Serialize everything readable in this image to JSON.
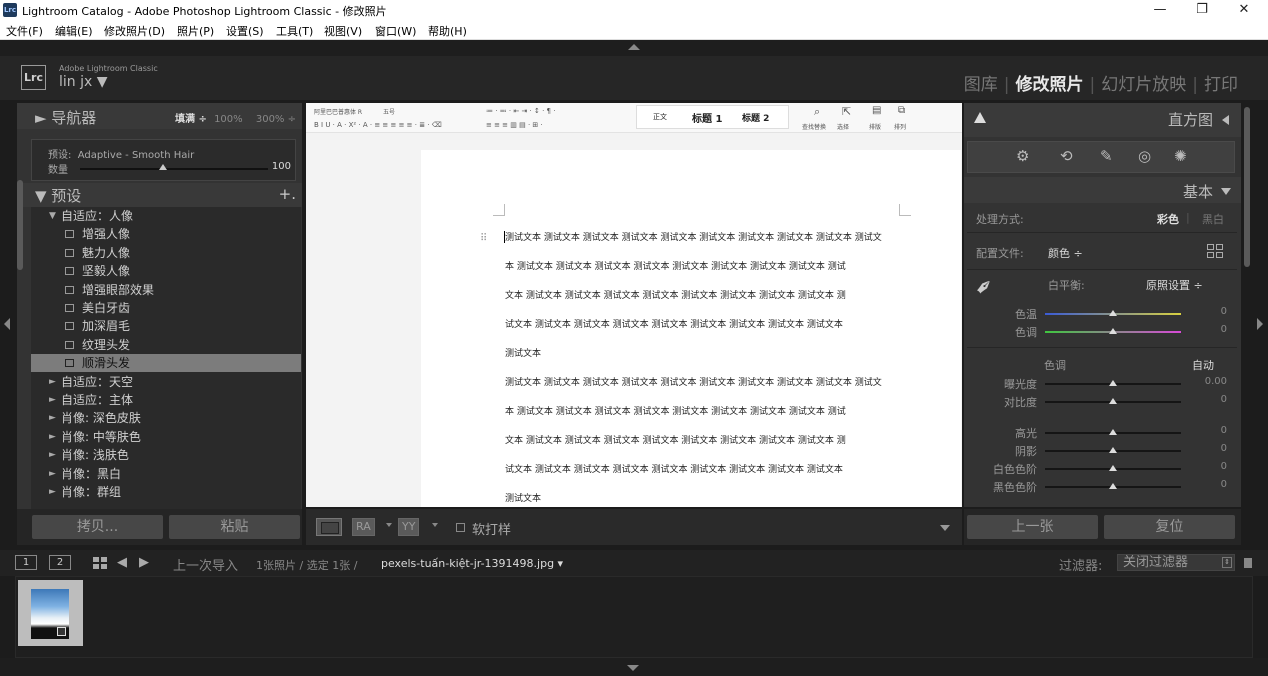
{
  "window": {
    "app_icon": "Lrc",
    "title": "Lightroom Catalog - Adobe Photoshop Lightroom Classic - 修改照片",
    "controls": {
      "minimize": "—",
      "restore": "❐",
      "close": "✕"
    }
  },
  "menu": [
    "文件(F)",
    "编辑(E)",
    "修改照片(D)",
    "照片(P)",
    "设置(S)",
    "工具(T)",
    "视图(V)",
    "窗口(W)",
    "帮助(H)"
  ],
  "identity": {
    "logo": "Lrc",
    "product": "Adobe Lightroom Classic",
    "user": "lin jx ▼"
  },
  "modules": {
    "items": [
      "图库",
      "修改照片",
      "幻灯片放映",
      "打印"
    ],
    "active": "修改照片",
    "separator": "|"
  },
  "left_panel": {
    "navigator": {
      "title": "► 导航器",
      "zoom_fill": "填满 ÷",
      "zoom_100": "100%",
      "zoom_300": "300% ÷"
    },
    "preset_amount": {
      "preset_label": "预设:",
      "preset_name": "Adaptive - Smooth Hair",
      "amount_label": "数量",
      "amount_value": "100",
      "amount_fraction": 1.0
    },
    "presets_header": {
      "title": "▼ 预设",
      "add_icon": "+."
    },
    "tree": [
      {
        "label": "自适应：人像",
        "arrow": "▼",
        "level": 0
      },
      {
        "label": "增强人像",
        "level": 1
      },
      {
        "label": "魅力人像",
        "level": 1
      },
      {
        "label": "坚毅人像",
        "level": 1
      },
      {
        "label": "增强眼部效果",
        "level": 1
      },
      {
        "label": "美白牙齿",
        "level": 1
      },
      {
        "label": "加深眉毛",
        "level": 1
      },
      {
        "label": "纹理头发",
        "level": 1
      },
      {
        "label": "顺滑头发",
        "level": 1,
        "selected": true
      },
      {
        "label": "自适应：天空",
        "arrow": "►",
        "level": 0
      },
      {
        "label": "自适应：主体",
        "arrow": "►",
        "level": 0
      },
      {
        "label": "肖像: 深色皮肤",
        "arrow": "►",
        "level": 0
      },
      {
        "label": "肖像: 中等肤色",
        "arrow": "►",
        "level": 0
      },
      {
        "label": "肖像: 浅肤色",
        "arrow": "►",
        "level": 0
      },
      {
        "label": "肖像：黑白",
        "arrow": "►",
        "level": 0
      },
      {
        "label": "肖像：群组",
        "arrow": "►",
        "level": 0
      }
    ],
    "buttons": {
      "copy": "拷贝...",
      "paste": "粘贴"
    }
  },
  "document": {
    "ribbon_font": "阿里巴巴普惠体 R",
    "ribbon_size": "五号",
    "styles": [
      "正文",
      "标题 1",
      "标题 2"
    ],
    "ribbon_right": [
      "查找替换",
      "选择",
      "排版",
      "排列"
    ],
    "paragraphs": [
      [
        "测试文本 测试文本 测试文本 测试文本 测试文本 测试文本 测试文本 测试文本 测试文本 测试文",
        "本 测试文本 测试文本 测试文本 测试文本 测试文本 测试文本 测试文本 测试文本 测试",
        "文本 测试文本 测试文本 测试文本 测试文本 测试文本 测试文本 测试文本 测试文本 测",
        "试文本 测试文本 测试文本 测试文本 测试文本 测试文本 测试文本 测试文本 测试文本",
        "测试文本"
      ],
      [
        "测试文本 测试文本 测试文本 测试文本 测试文本 测试文本 测试文本 测试文本 测试文本 测试文",
        "本 测试文本 测试文本 测试文本 测试文本 测试文本 测试文本 测试文本 测试文本 测试",
        "文本 测试文本 测试文本 测试文本 测试文本 测试文本 测试文本 测试文本 测试文本 测",
        "试文本 测试文本 测试文本 测试文本 测试文本 测试文本 测试文本 测试文本 测试文本",
        "测试文本"
      ]
    ],
    "para_handle": "⠿"
  },
  "toolbar": {
    "ra": "RA",
    "yy": "YY",
    "softproof": "软打样"
  },
  "right_panel": {
    "histogram_title": "直方图",
    "tools": [
      "⚙",
      "⟲",
      "✎",
      "◎",
      "✺"
    ],
    "basic_title": "基本",
    "treatment": {
      "label": "处理方式:",
      "color": "彩色",
      "bw": "黑白"
    },
    "profile": {
      "label": "配置文件:",
      "value": "颜色 ÷"
    },
    "wb": {
      "label": "白平衡:",
      "value": "原照设置 ÷"
    },
    "tone_header": {
      "label": "色调",
      "auto": "自动"
    },
    "sliders": [
      {
        "label": "色温",
        "value": "0",
        "fraction": 0.5
      },
      {
        "label": "色调",
        "value": "0",
        "fraction": 0.5
      },
      {
        "label": "曝光度",
        "value": "0.00",
        "fraction": 0.5
      },
      {
        "label": "对比度",
        "value": "0",
        "fraction": 0.5
      },
      {
        "label": "高光",
        "value": "0",
        "fraction": 0.5
      },
      {
        "label": "阴影",
        "value": "0",
        "fraction": 0.5
      },
      {
        "label": "白色色阶",
        "value": "0",
        "fraction": 0.5
      },
      {
        "label": "黑色色阶",
        "value": "0",
        "fraction": 0.5
      }
    ],
    "buttons": {
      "previous": "上一张",
      "reset": "复位"
    }
  },
  "filmstrip_bar": {
    "page1": "1",
    "page2": "2",
    "source": "上一次导入",
    "count_text": "1张照片 / 选定 1张 /",
    "filename": "pexels-tuấn-kiệt-jr-1391498.jpg ▾",
    "filter_label": "过滤器:",
    "filter_value": "关闭过滤器"
  },
  "colors": {
    "bg": "#1c1c1c",
    "panel": "#333333",
    "selected_row": "#7c7c7c",
    "doc_bg": "#ffffff"
  }
}
